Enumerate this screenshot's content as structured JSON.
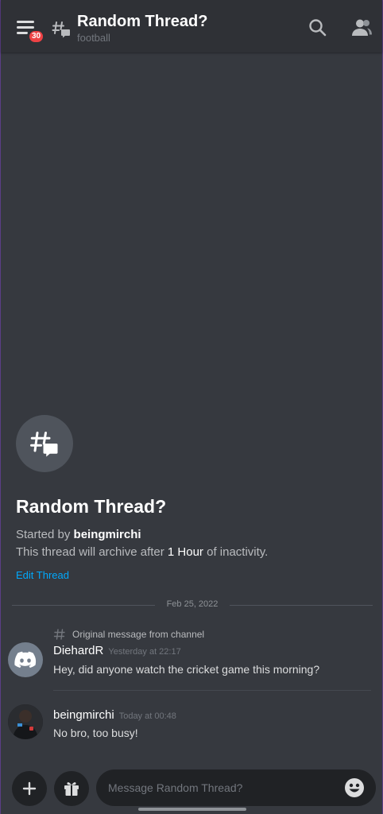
{
  "header": {
    "notification_count": "30",
    "title": "Random Thread?",
    "subtitle": "football"
  },
  "thread": {
    "heading": "Random Thread?",
    "started_by_prefix": "Started by ",
    "started_by_user": "beingmirchi",
    "archive_prefix": "This thread will archive after ",
    "archive_duration": "1 Hour",
    "archive_suffix": " of inactivity.",
    "edit_label": "Edit Thread"
  },
  "date_divider": "Feb 25, 2022",
  "messages": [
    {
      "reference": "Original message from channel",
      "author": "DiehardR",
      "time": "Yesterday at 22:17",
      "text": "Hey, did anyone watch the cricket game this morning?"
    },
    {
      "author": "beingmirchi",
      "time": "Today at 00:48",
      "text": "No bro, too busy!"
    }
  ],
  "composer": {
    "placeholder": "Message Random Thread?"
  },
  "icons": [
    "hamburger-icon",
    "thread-icon",
    "search-icon",
    "members-icon",
    "plus-icon",
    "gift-icon",
    "emoji-icon",
    "discord-logo-icon"
  ],
  "colors": {
    "background": "#36393f",
    "header": "#2f3136",
    "badge": "#ed4245",
    "link": "#00a8fc",
    "input": "#202225"
  }
}
